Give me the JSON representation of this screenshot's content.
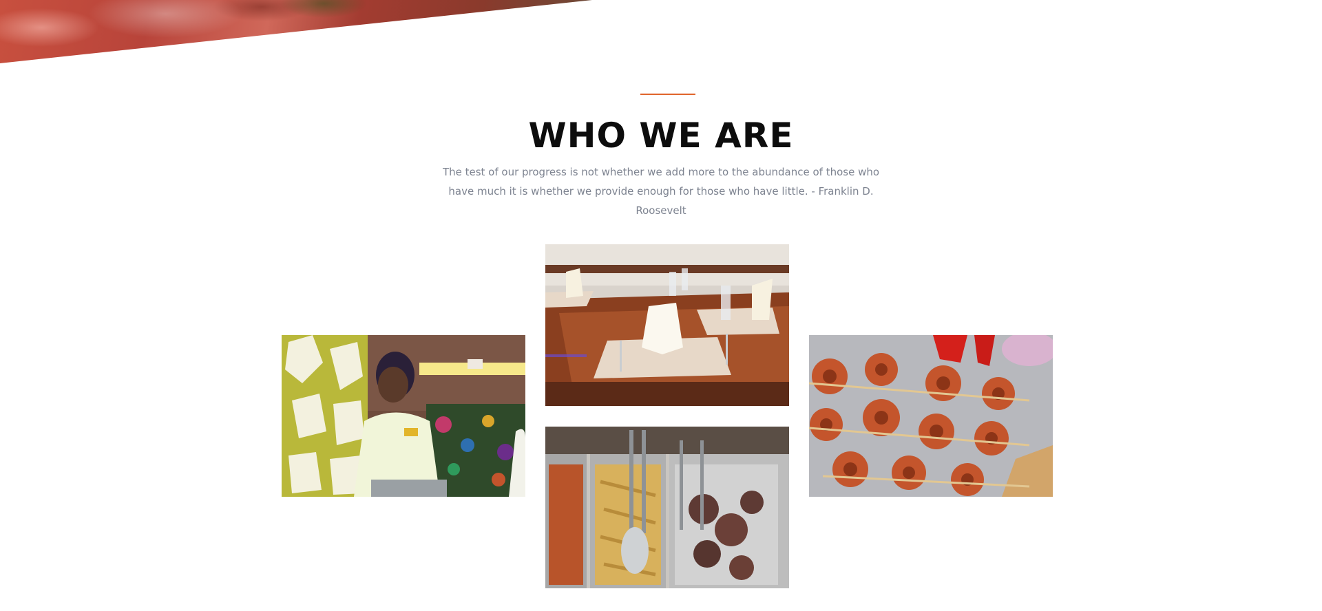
{
  "section": {
    "title": "WHO WE ARE",
    "quote": "The test of our progress is not whether we add more to the abundance of those who have much it is whether we provide enough for those who have little. - Franklin D. Roosevelt"
  },
  "colors": {
    "accent": "#e0652c",
    "title": "#0d0d0d",
    "quote_text": "#7d8390",
    "background": "#ffffff"
  },
  "gallery": {
    "images": [
      {
        "name": "staff-photo",
        "subject": "smiling staff member in uniform at buffet counter"
      },
      {
        "name": "dining-table-photo",
        "subject": "set dining tables with folded napkins and glasses"
      },
      {
        "name": "buffet-tray-photo",
        "subject": "buffet trays with plantain chips and meat with serving tongs"
      },
      {
        "name": "grilled-prawns-photo",
        "subject": "grilled prawn skewers on a platter"
      }
    ]
  }
}
